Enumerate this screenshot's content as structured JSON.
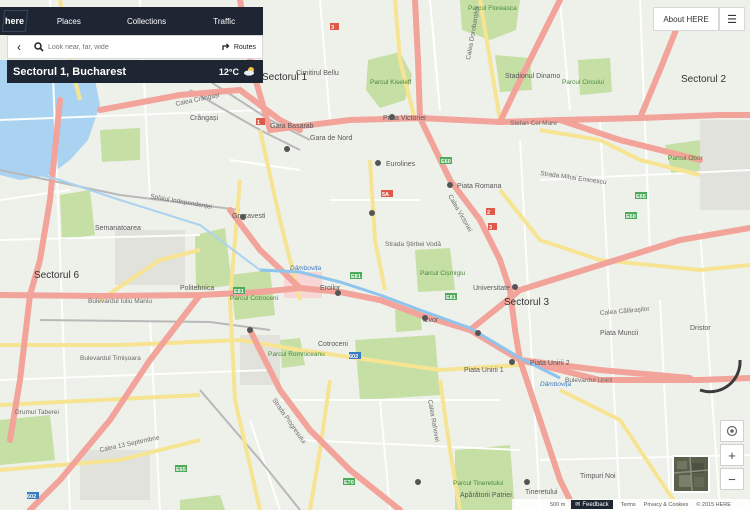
{
  "nav": {
    "logo_text": "here",
    "tabs": [
      "Places",
      "Collections",
      "Traffic"
    ]
  },
  "search": {
    "placeholder": "Look near, far, wide",
    "routes_label": "Routes"
  },
  "info": {
    "title": "Sectorul 1, Bucharest",
    "temperature": "12°C",
    "weather_icon": "partly-cloudy-icon"
  },
  "top_right": {
    "about_label": "About HERE",
    "menu_icon": "hamburger-icon"
  },
  "map_controls": {
    "locate_icon": "locate-icon",
    "zoom_in": "+",
    "zoom_out": "−"
  },
  "footer": {
    "scale_label": "500 m",
    "feedback_label": "Feedback",
    "terms_label": "Terms",
    "privacy_label": "Privacy & Cookies",
    "copyright": "© 2015 HERE"
  },
  "map_labels": {
    "sectors": [
      "Sectorul 1",
      "Sectorul 2",
      "Sectorul 3",
      "Sectorul 6"
    ],
    "places": [
      "Parcul Kiseleff",
      "Cimitirul Bellu",
      "Parcul Floreasca",
      "Parcul Circului",
      "Parcul Obor",
      "Parcul Cișmigiu",
      "Parcul Cotroceni",
      "Parcul Romniceanu",
      "Parcul Tineretului",
      "Stadionul Dinamo",
      "Gara de Nord",
      "Gara Basarab",
      "Eurolines",
      "Piata Victoriei",
      "Piata Romana",
      "Universitate",
      "Piata Unirii 1",
      "Piata Unirii 2",
      "Izvor",
      "Cotroceni",
      "Crângași",
      "Grozavesti",
      "Eroilor",
      "Politehnica",
      "Semanatoarea",
      "Piata Muncii",
      "Dristor",
      "Timpuri Noi",
      "Tineretului",
      "Apărătorii Patriei"
    ],
    "streets": [
      "Calea Crângași",
      "Calea Victoriei",
      "Calea Dorobanților",
      "Bulevardul Iuliu Maniu",
      "Bulevardul Unirii",
      "Calea Călărașilor",
      "Stefan Cel Mare",
      "Strada Mihai Eminescu",
      "Strada Știrbei Vodă",
      "Bulevardul Timișoara",
      "Drumul Taberei",
      "Calea Rahovei",
      "Splaiul Independenței",
      "Calea 13 Septembrie",
      "Strada Progresului"
    ],
    "water": [
      "Dâmbovița",
      "Dâmbovița"
    ]
  },
  "colors": {
    "panel_bg": "#1e2533",
    "road_major": "#f2a39a",
    "road_secondary": "#f7e493",
    "park": "#c5dfa5",
    "water": "#a9d3f0",
    "land": "#eef0ea"
  }
}
